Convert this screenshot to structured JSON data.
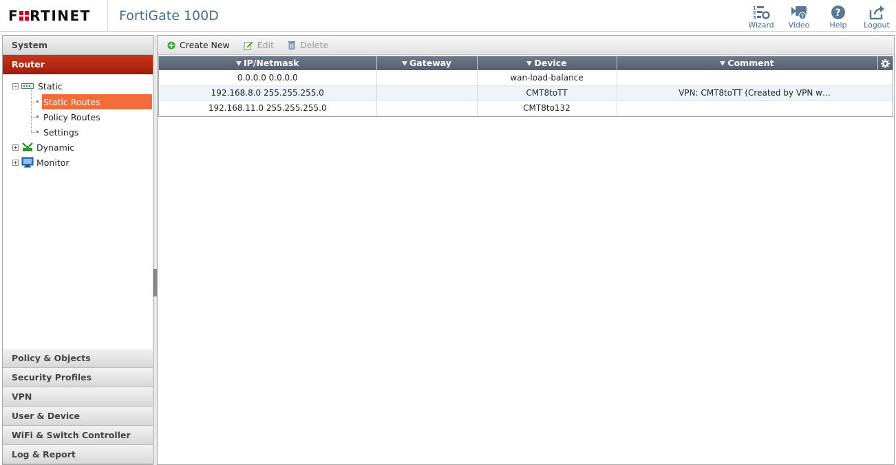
{
  "header": {
    "logo_text": "FORTINET",
    "device_title": "FortiGate 100D",
    "tools": [
      {
        "label": "Wizard",
        "icon": "wizard-icon"
      },
      {
        "label": "Video",
        "icon": "video-icon"
      },
      {
        "label": "Help",
        "icon": "help-icon"
      },
      {
        "label": "Logout",
        "icon": "logout-icon"
      }
    ]
  },
  "nav": {
    "top_sections": [
      "System",
      "Router"
    ],
    "tree": {
      "static": "Static",
      "static_routes": "Static Routes",
      "policy_routes": "Policy Routes",
      "settings": "Settings",
      "dynamic": "Dynamic",
      "monitor": "Monitor"
    },
    "bottom_sections": [
      "Policy & Objects",
      "Security Profiles",
      "VPN",
      "User & Device",
      "WiFi & Switch Controller",
      "Log & Report"
    ]
  },
  "toolbar": {
    "create_new": "Create New",
    "edit": "Edit",
    "delete": "Delete"
  },
  "table": {
    "columns": [
      "IP/Netmask",
      "Gateway",
      "Device",
      "Comment"
    ],
    "rows": [
      {
        "ip": "0.0.0.0 0.0.0.0",
        "gateway": "",
        "device": "wan-load-balance",
        "comment": ""
      },
      {
        "ip": "192.168.8.0 255.255.255.0",
        "gateway": "",
        "device": "CMT8toTT",
        "comment": "VPN: CMT8toTT (Created by VPN w…"
      },
      {
        "ip": "192.168.11.0 255.255.255.0",
        "gateway": "",
        "device": "CMT8to132",
        "comment": ""
      }
    ]
  },
  "colors": {
    "brand_red": "#d0021b",
    "active_section": "#b0260c",
    "selected_item": "#f26b3a",
    "header_blue": "#4a6b8a"
  }
}
